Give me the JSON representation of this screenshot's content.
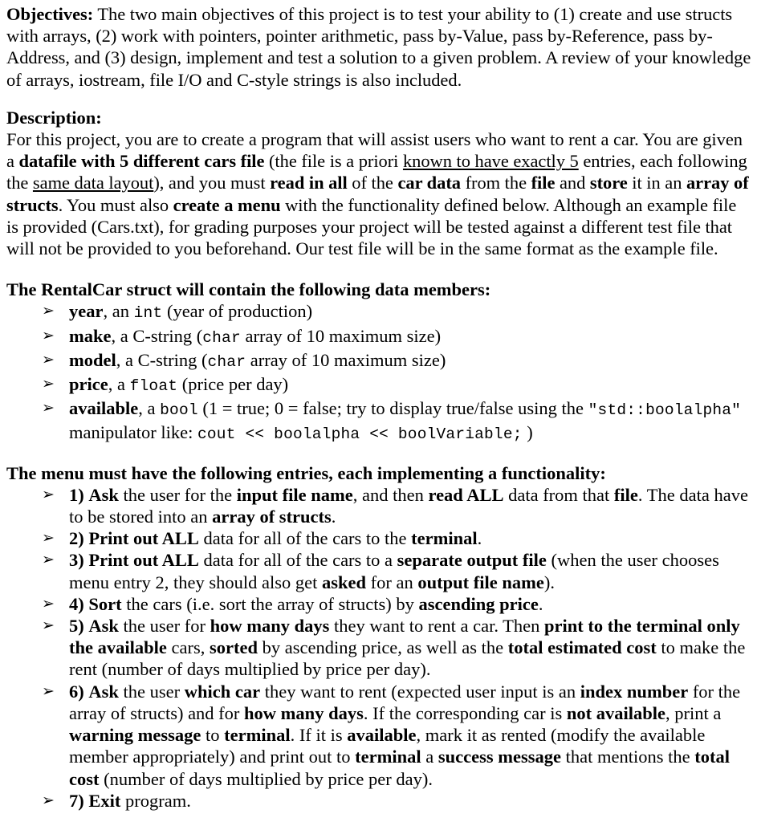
{
  "document": {
    "bullet_glyph": "➢",
    "objectives": {
      "heading": "Objectives:",
      "intro_gap": "   ",
      "body_1": "The two main objectives of this project is to test your ability to (1) create and use structs with arrays, (2) work with pointers, pointer arithmetic, pass by-Value, pass by-Reference, pass by-Address, and (3) design, implement and test a solution to a given problem. A review of your knowledge of arrays, iostream, file I/O and C-style strings is also included."
    },
    "description": {
      "heading": "Description:",
      "seg_1": "For this project, you are to create a program that will assist users who want to rent a car. You are given a ",
      "seg_2_bold": "datafile with 5 different cars file",
      "seg_3": " (the file is a priori ",
      "seg_4_underline": "known to have exactly 5",
      "seg_5": " entries, each following the ",
      "seg_6_underline": "same data layout",
      "seg_7": "), and you must ",
      "seg_8_bold": "read in all",
      "seg_9": " of the ",
      "seg_10_bold": "car data",
      "seg_11": " from the ",
      "seg_12_bold": "file",
      "seg_13": " and ",
      "seg_14_bold": "store",
      "seg_15": " it in an ",
      "seg_16_bold": "array of structs",
      "seg_17": ". You must also ",
      "seg_18_bold": "create a menu",
      "seg_19": " with the functionality defined below. Although an example file is provided (Cars.txt), for grading purposes your project will be tested against a different test file that will not be provided to you beforehand. Our test file will be in the same format as the example file."
    },
    "struct_section": {
      "heading": "The RentalCar struct will contain the following data members:",
      "members": [
        {
          "name": "year",
          "pre": ", an ",
          "type_code": "int",
          "post": " (year of production)"
        },
        {
          "name": "make",
          "pre": ", a C-string (",
          "type_code": "char",
          "post": " array of 10 maximum size)"
        },
        {
          "name": "model",
          "pre": ", a C-string (",
          "type_code": "char",
          "post": " array of 10 maximum size)"
        },
        {
          "name": "price",
          "pre": ", a ",
          "type_code": "float",
          "post": " (price per day)"
        },
        {
          "name": "available",
          "pre": ", a ",
          "type_code": "bool",
          "post": " (1 = true; 0 = false; try to display true/false using the ",
          "code_2": "\"std::boolalpha\"",
          "post_2": " manipulator like: ",
          "code_3": "cout << boolalpha << boolVariable;",
          "post_3": " )"
        }
      ]
    },
    "menu_section": {
      "heading": "The menu must have the following entries, each implementing a functionality:",
      "entries": [
        {
          "number": "1)",
          "lead_bold": "Ask",
          "parts": [
            {
              "text": " the user for the ",
              "style": "normal"
            },
            {
              "text": "input file name",
              "style": "bold"
            },
            {
              "text": ", and then ",
              "style": "normal"
            },
            {
              "text": "read ALL",
              "style": "bold"
            },
            {
              "text": " data from that ",
              "style": "normal"
            },
            {
              "text": "file",
              "style": "bold"
            },
            {
              "text": ". The data have to be stored into an ",
              "style": "normal"
            },
            {
              "text": "array of structs",
              "style": "bold"
            },
            {
              "text": ".",
              "style": "normal"
            }
          ]
        },
        {
          "number": "2)",
          "lead_bold": "Print out ALL",
          "parts": [
            {
              "text": " data for all of the cars to the ",
              "style": "normal"
            },
            {
              "text": "terminal",
              "style": "bold"
            },
            {
              "text": ".",
              "style": "normal"
            }
          ]
        },
        {
          "number": "3)",
          "lead_bold": "Print out ALL",
          "parts": [
            {
              "text": " data for all of the cars to a ",
              "style": "normal"
            },
            {
              "text": "separate output file",
              "style": "bold"
            },
            {
              "text": " (when the user chooses menu entry 2, they should also get ",
              "style": "normal"
            },
            {
              "text": "asked",
              "style": "bold"
            },
            {
              "text": " for an ",
              "style": "normal"
            },
            {
              "text": "output file name",
              "style": "bold"
            },
            {
              "text": ").",
              "style": "normal"
            }
          ]
        },
        {
          "number": "4)",
          "lead_bold": "Sort",
          "parts": [
            {
              "text": " the cars (i.e. sort the array of structs) by ",
              "style": "normal"
            },
            {
              "text": "ascending price",
              "style": "bold"
            },
            {
              "text": ".",
              "style": "normal"
            }
          ]
        },
        {
          "number": "5)",
          "lead_bold": "Ask",
          "parts": [
            {
              "text": " the user for ",
              "style": "normal"
            },
            {
              "text": "how many days",
              "style": "bold"
            },
            {
              "text": " they want to rent a car. Then ",
              "style": "normal"
            },
            {
              "text": "print to the terminal only the available",
              "style": "bold"
            },
            {
              "text": " cars, ",
              "style": "normal"
            },
            {
              "text": "sorted",
              "style": "bold"
            },
            {
              "text": " by ascending price, as well as the ",
              "style": "normal"
            },
            {
              "text": "total estimated cost",
              "style": "bold"
            },
            {
              "text": " to make the rent (number of days multiplied by price per day).",
              "style": "normal"
            }
          ]
        },
        {
          "number": "6)",
          "lead_bold": "Ask",
          "parts": [
            {
              "text": " the user ",
              "style": "normal"
            },
            {
              "text": "which car",
              "style": "bold"
            },
            {
              "text": " they want to rent (expected user input is an ",
              "style": "normal"
            },
            {
              "text": "index number",
              "style": "bold"
            },
            {
              "text": " for the array of structs) and for ",
              "style": "normal"
            },
            {
              "text": "how many days",
              "style": "bold"
            },
            {
              "text": ". If the corresponding car is ",
              "style": "normal"
            },
            {
              "text": "not available",
              "style": "bold"
            },
            {
              "text": ", print a ",
              "style": "normal"
            },
            {
              "text": "warning message",
              "style": "bold"
            },
            {
              "text": " to ",
              "style": "normal"
            },
            {
              "text": "terminal",
              "style": "bold"
            },
            {
              "text": ". If it is ",
              "style": "normal"
            },
            {
              "text": "available",
              "style": "bold"
            },
            {
              "text": ", mark it as rented (modify the available member appropriately) and print out to ",
              "style": "normal"
            },
            {
              "text": "terminal",
              "style": "bold"
            },
            {
              "text": " a ",
              "style": "normal"
            },
            {
              "text": "success message",
              "style": "bold"
            },
            {
              "text": " that mentions the ",
              "style": "normal"
            },
            {
              "text": "total cost",
              "style": "bold"
            },
            {
              "text": " (number of days multiplied by price per day).",
              "style": "normal"
            }
          ]
        },
        {
          "number": "7)",
          "lead_bold": "Exit",
          "parts": [
            {
              "text": " program.",
              "style": "normal"
            }
          ]
        }
      ]
    }
  }
}
